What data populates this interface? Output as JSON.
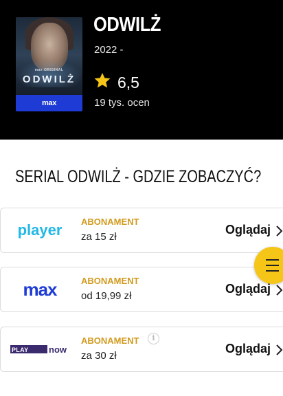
{
  "header": {
    "poster": {
      "brand_small": "max ORIGINAL",
      "title": "ODWILŻ",
      "platform": "max"
    },
    "title": "ODWILŻ",
    "year": "2022 -",
    "rating": "6,5",
    "votes": "19 tys. ocen",
    "star_color": "#f5c518"
  },
  "section": {
    "title": "SERIAL ODWILŻ - GDZIE ZOBACZYĆ?"
  },
  "offers": [
    {
      "provider": "player",
      "type": "ABONAMENT",
      "price": "za 15 zł",
      "action": "Oglądaj"
    },
    {
      "provider": "max",
      "type": "ABONAMENT",
      "price": "od 19,99 zł",
      "action": "Oglądaj"
    },
    {
      "provider": "PLAY now",
      "type": "ABONAMENT",
      "price": "za 30 zł",
      "action": "Oglądaj"
    }
  ],
  "colors": {
    "accent": "#f5c518",
    "subscription": "#d19a1e",
    "player": "#22b8e6",
    "max": "#1e3bd6",
    "playnow_purple": "#3b2a6e"
  },
  "fab": {
    "icon": "menu-icon"
  }
}
